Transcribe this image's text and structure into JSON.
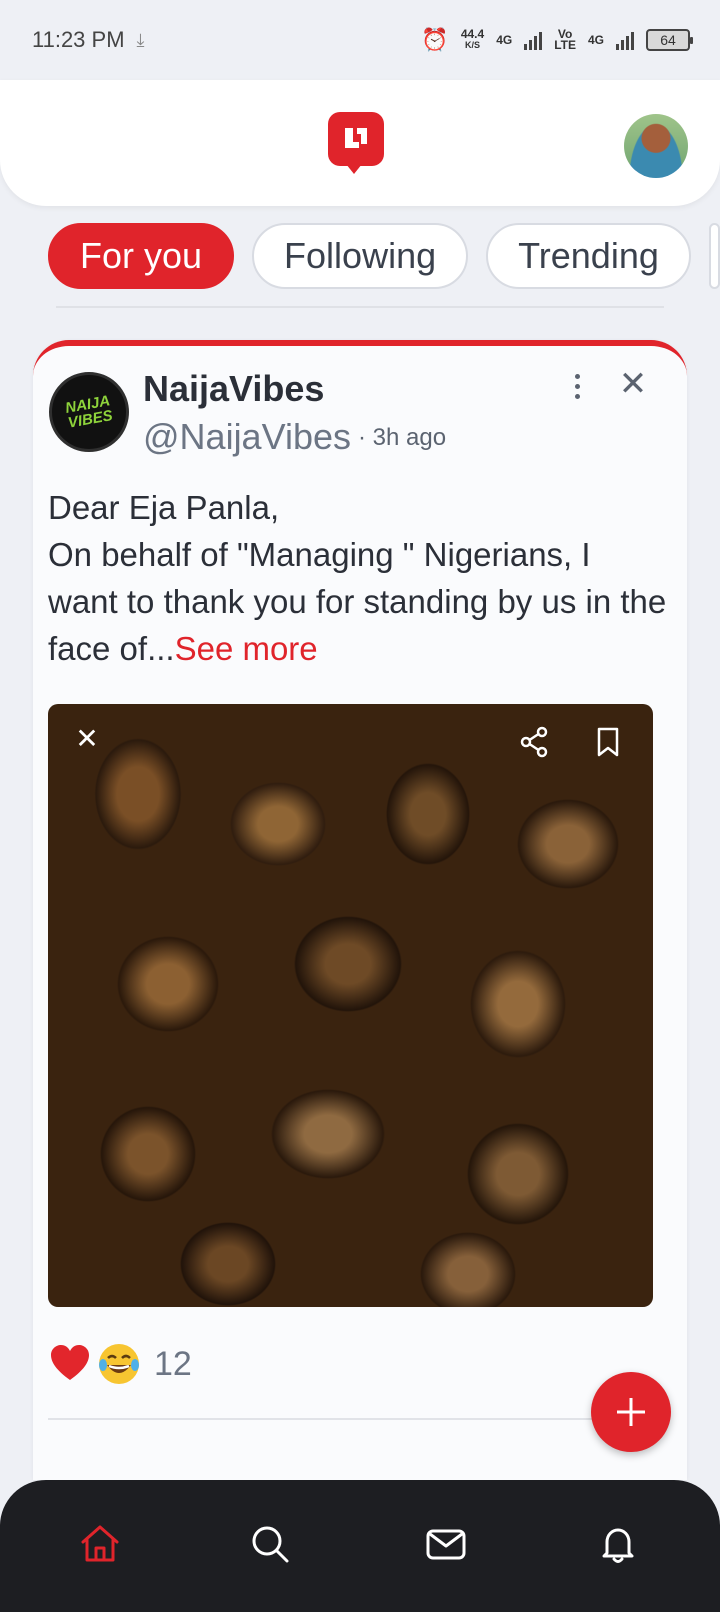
{
  "status_bar": {
    "time": "11:23 PM",
    "speed_value": "44.4",
    "speed_unit": "K/S",
    "network1": "4G",
    "network2_top": "Vo",
    "network2_bottom": "LTE",
    "network3": "4G",
    "battery": "64"
  },
  "header": {
    "logo_icon": "brand-logo-icon",
    "avatar_icon": "user-avatar"
  },
  "tabs": [
    {
      "label": "For you",
      "active": true
    },
    {
      "label": "Following",
      "active": false
    },
    {
      "label": "Trending",
      "active": false
    }
  ],
  "post": {
    "author_name": "NaijaVibes",
    "author_handle": "@NaijaVibes",
    "time": "3h ago",
    "avatar_badge": "NAIJA VIBES",
    "text_line1": "Dear Eja Panla,",
    "text_body": "On behalf of \"Managing \" Nigerians, I want to thank you for standing by us in the face of...",
    "see_more": "See more",
    "reaction_count": "12"
  },
  "bottom_nav": [
    "home-icon",
    "search-icon",
    "messages-icon",
    "notifications-icon"
  ],
  "colors": {
    "accent": "#e0242b",
    "background": "#eef0f5",
    "nav_background": "#1d1e22"
  }
}
